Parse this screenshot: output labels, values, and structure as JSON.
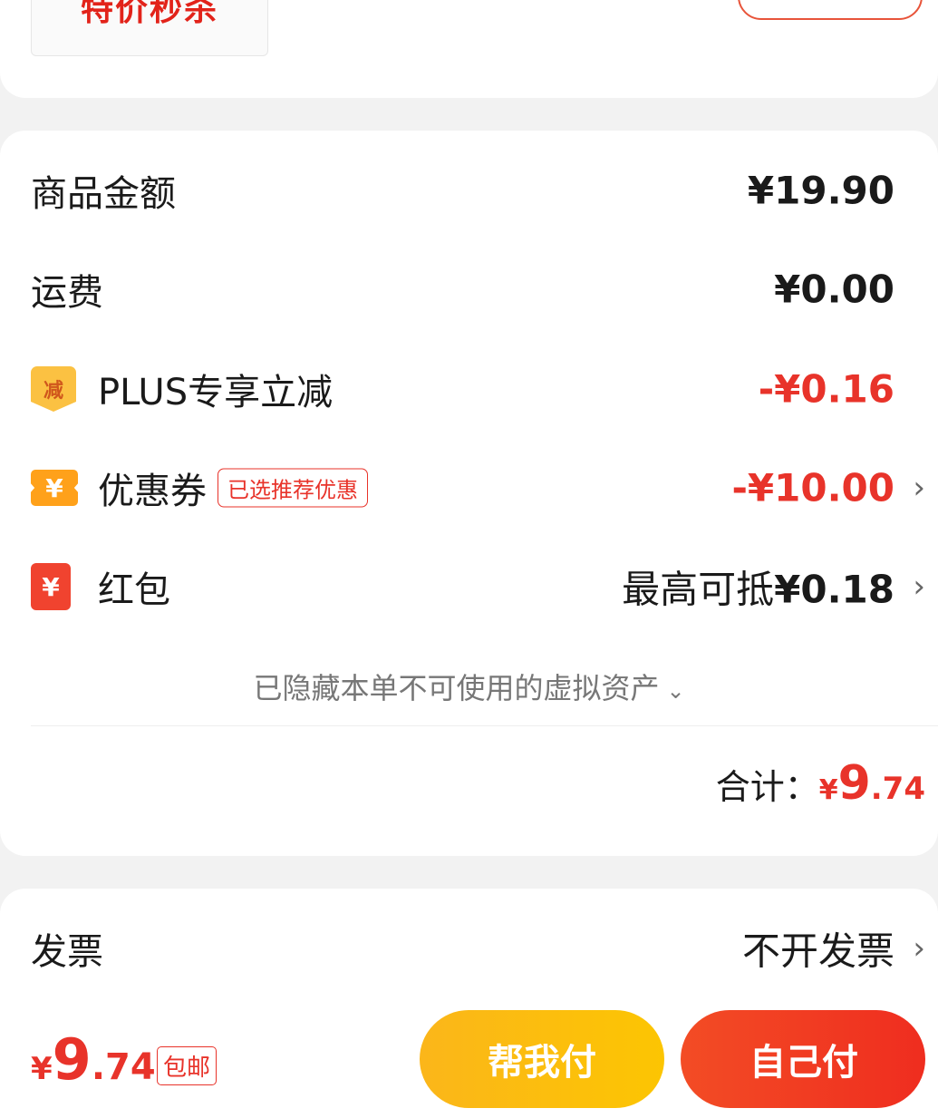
{
  "product": {
    "thumbnail_text": "特价秒杀"
  },
  "summary": {
    "goods_amount": {
      "label": "商品金额",
      "value": "¥19.90"
    },
    "shipping": {
      "label": "运费",
      "value": "¥0.00"
    },
    "plus_discount": {
      "label": "PLUS专享立减",
      "icon": "减",
      "value": "-¥0.16"
    },
    "coupon": {
      "label": "优惠券",
      "icon": "¥",
      "tag": "已选推荐优惠",
      "value": "-¥10.00"
    },
    "red_packet": {
      "label": "红包",
      "icon": "¥",
      "value_prefix": "最高可抵",
      "value": "¥0.18"
    },
    "hidden_assets_note": "已隐藏本单不可使用的虚拟资产",
    "total": {
      "label": "合计：",
      "currency": "¥",
      "integer": "9",
      "decimal": ".74"
    }
  },
  "invoice": {
    "label": "发票",
    "value": "不开发票"
  },
  "bottom_bar": {
    "price": {
      "currency": "¥",
      "integer": "9",
      "decimal": ".74"
    },
    "free_shipping_tag": "包邮",
    "help_pay_button": "帮我付",
    "self_pay_button": "自己付"
  },
  "colors": {
    "accent_red": "#e8332a",
    "help_button": "#fcc502",
    "pay_button": "#f13a22"
  }
}
